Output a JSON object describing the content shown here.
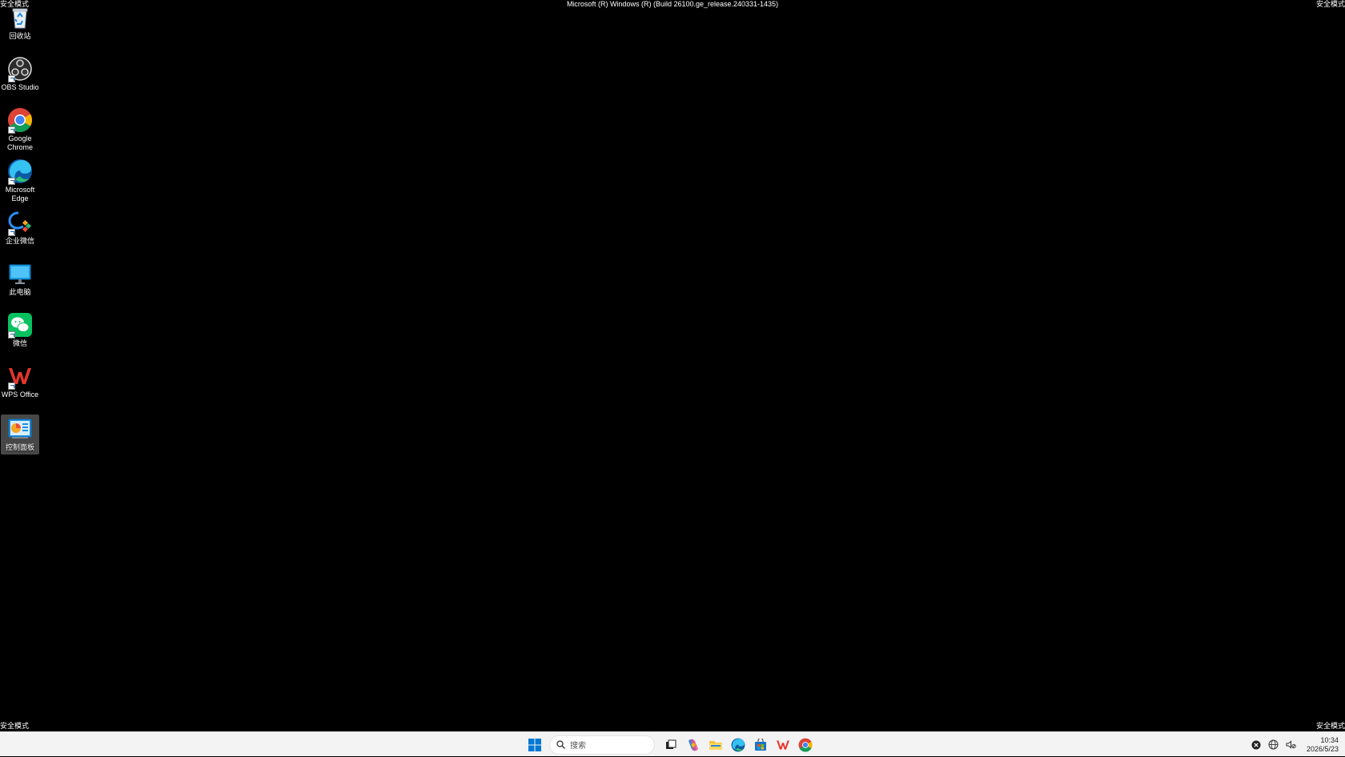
{
  "watermark": {
    "top_left": "安全模式",
    "top_right": "安全模式",
    "bottom_left": "安全模式",
    "bottom_right": "安全模式",
    "build": "Microsoft (R) Windows (R) (Build 26100.ge_release.240331-1435)"
  },
  "desktop_icons": [
    {
      "label": "回收站",
      "icon": "recycle-bin-icon"
    },
    {
      "label": "OBS Studio",
      "icon": "obs-studio-icon"
    },
    {
      "label": "Google Chrome",
      "icon": "chrome-icon"
    },
    {
      "label": "Microsoft Edge",
      "icon": "edge-icon"
    },
    {
      "label": "企业微信",
      "icon": "wecom-icon"
    },
    {
      "label": "此电脑",
      "icon": "this-pc-icon"
    },
    {
      "label": "微信",
      "icon": "wechat-icon"
    },
    {
      "label": "WPS Office",
      "icon": "wps-office-icon"
    },
    {
      "label": "控制面板",
      "icon": "control-panel-icon",
      "selected": true
    }
  ],
  "taskbar": {
    "search_placeholder": "搜索",
    "pinned": [
      "task-view-icon",
      "copilot-icon",
      "file-explorer-icon",
      "edge-icon",
      "store-icon",
      "wps-icon",
      "chrome-icon"
    ],
    "clock": {
      "time": "10:34",
      "date": "2026/5/23"
    }
  },
  "colors": {
    "desktop": "#000000",
    "taskbar": "#f3f3f3",
    "accent": "#0078d4"
  }
}
